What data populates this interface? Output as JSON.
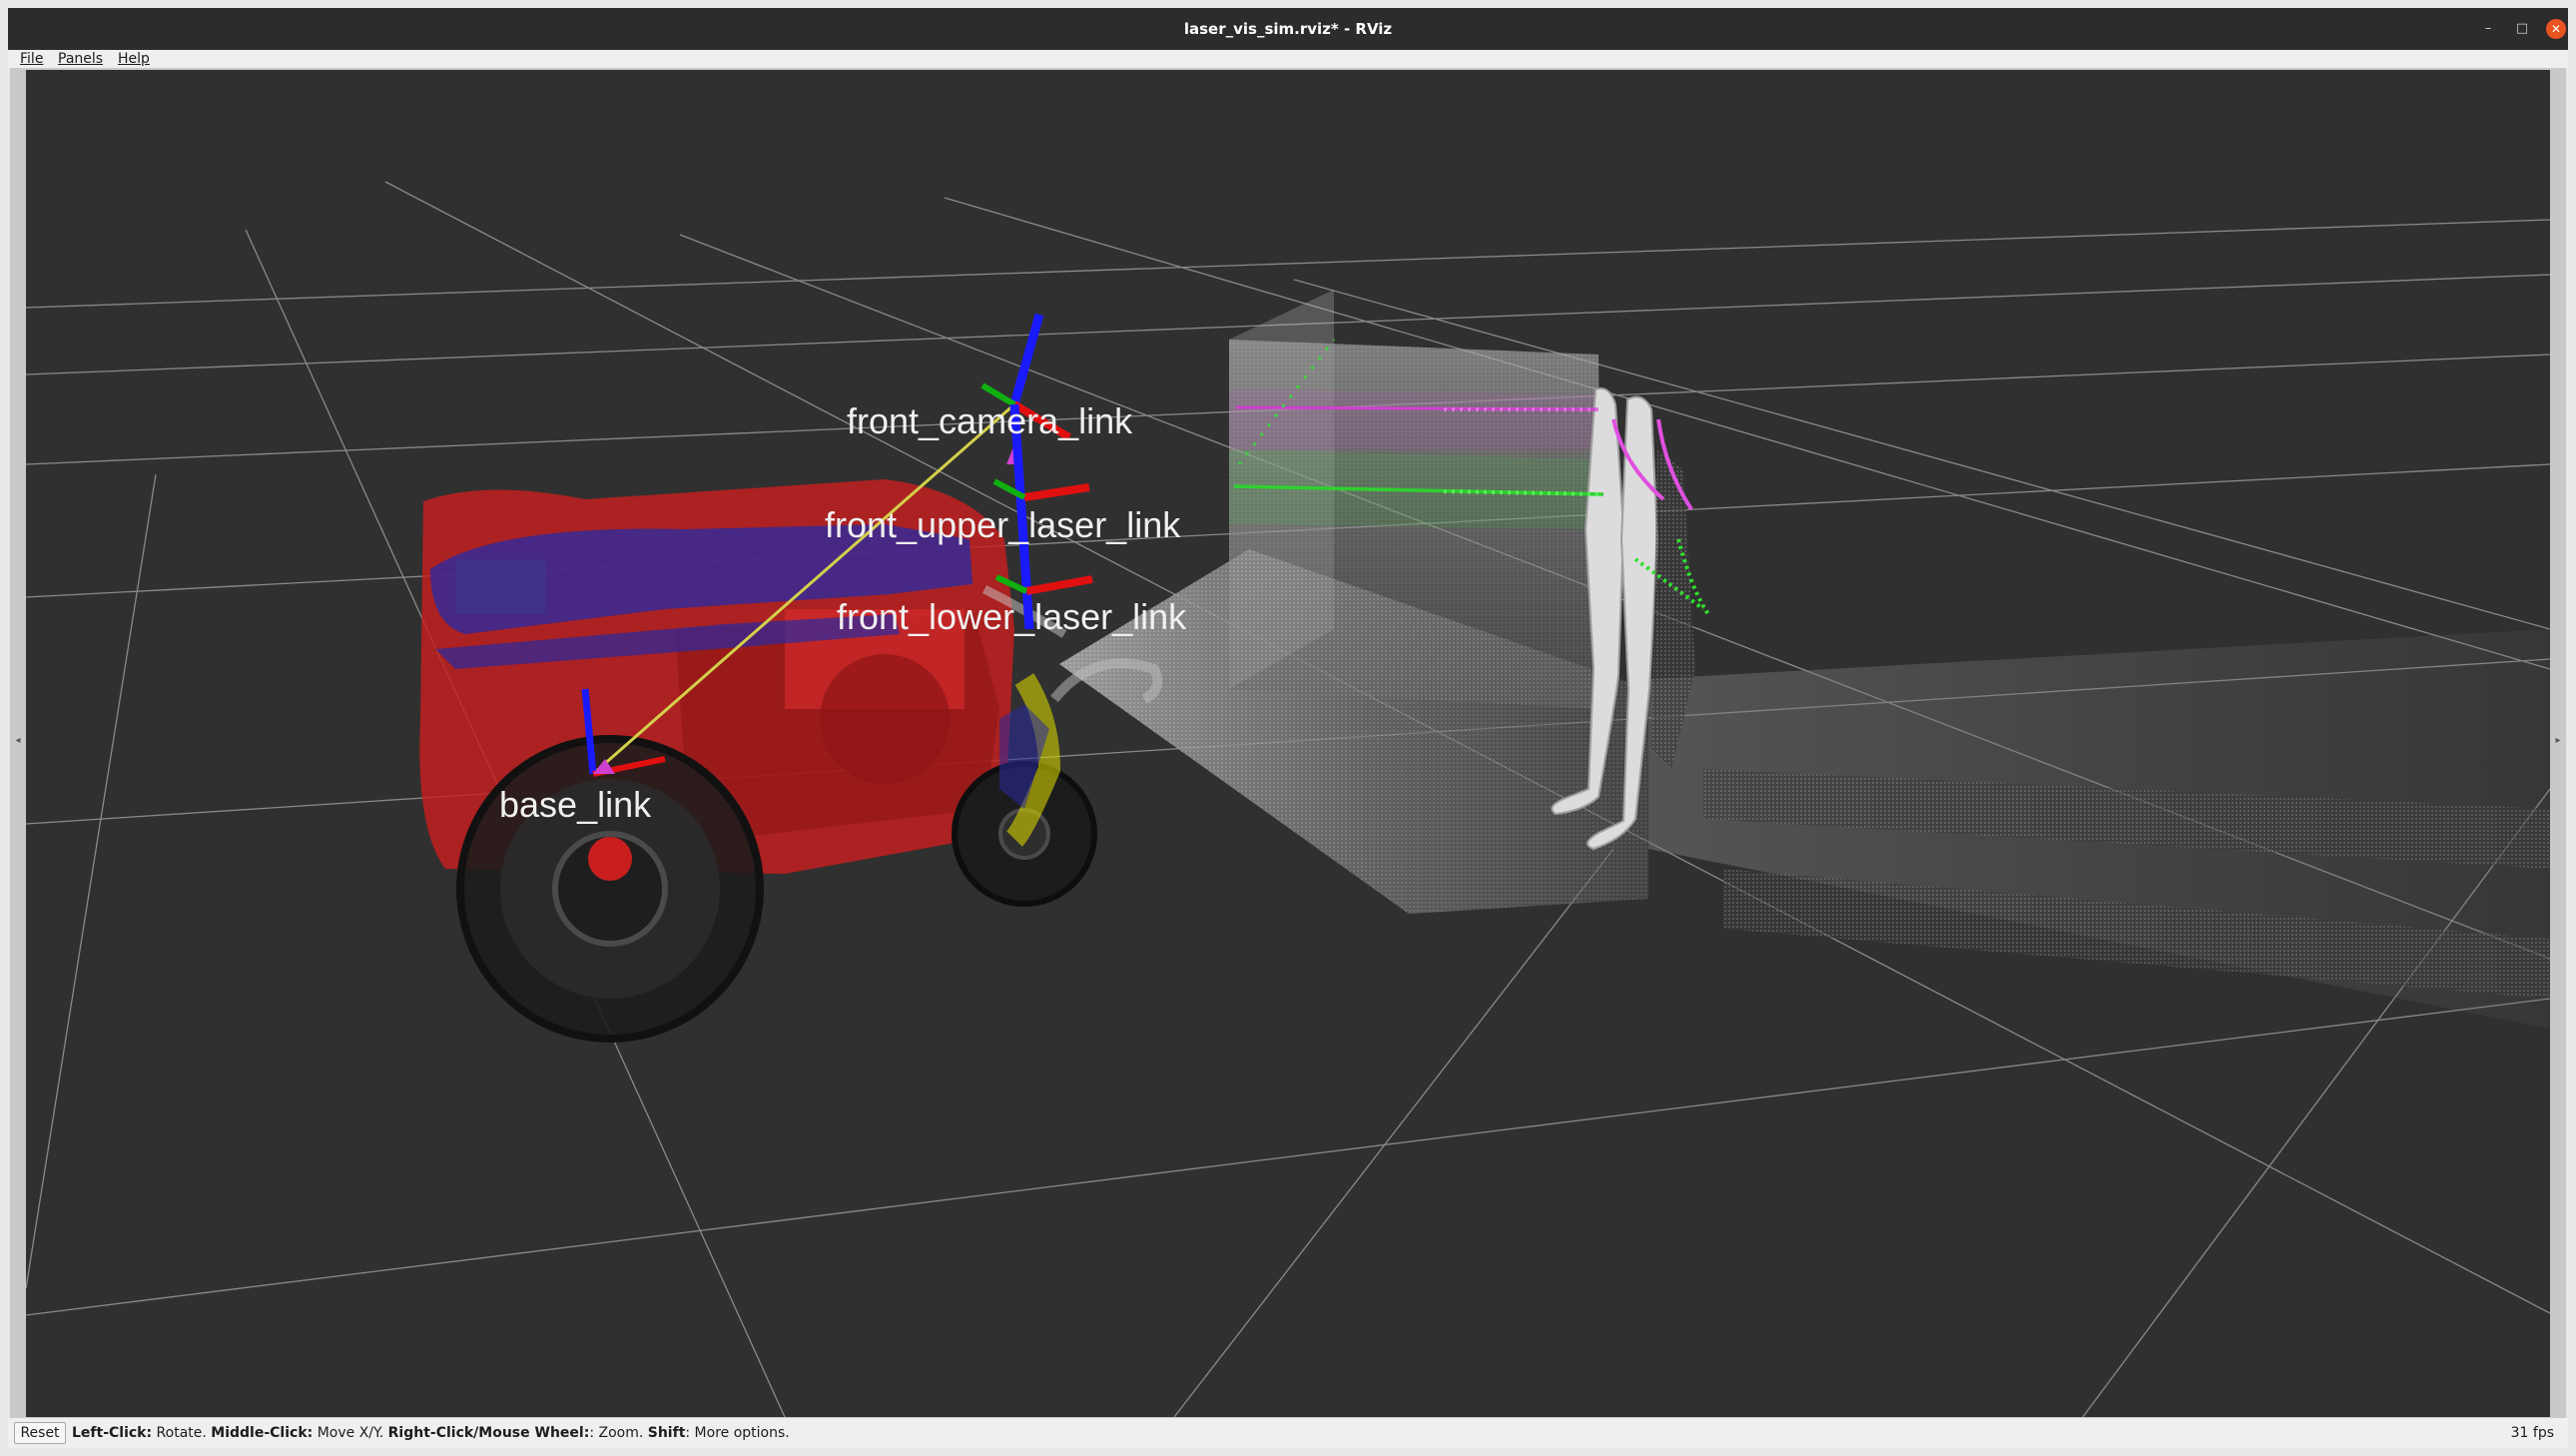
{
  "window": {
    "title": "laser_vis_sim.rviz* - RViz",
    "controls": {
      "minimize": "–",
      "maximize": "□",
      "close": "✕"
    }
  },
  "menu": [
    {
      "label": "File"
    },
    {
      "label": "Panels"
    },
    {
      "label": "Help"
    }
  ],
  "scene": {
    "frame_labels": {
      "front_camera_link": "front_camera_link",
      "front_upper_laser_link": "front_upper_laser_link",
      "front_lower_laser_link": "front_lower_laser_link",
      "base_link": "base_link"
    },
    "colors": {
      "background": "#303030",
      "grid": "#a0a0a0",
      "robot_body": "#c81e1e",
      "robot_frame": "#2a2aa0",
      "x_axis": "#e01010",
      "y_axis": "#10b010",
      "z_axis": "#1a1aff",
      "tf_link": "#d4d04a",
      "upper_scan": "#d040d0",
      "lower_scan": "#30d030",
      "depth_cloud": "#d8d8d8"
    }
  },
  "statusbar": {
    "reset_label": "Reset",
    "hint": [
      {
        "key": "Left-Click:",
        "action": " Rotate. "
      },
      {
        "key": "Middle-Click:",
        "action": " Move X/Y. "
      },
      {
        "key": "Right-Click/Mouse Wheel:",
        "action": ": Zoom. "
      },
      {
        "key": "Shift",
        "action": ": More options."
      }
    ],
    "fps": "31 fps"
  }
}
